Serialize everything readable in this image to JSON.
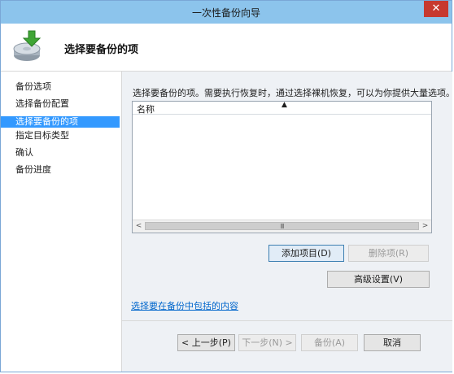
{
  "window": {
    "title": "一次性备份向导",
    "close_label": "✕"
  },
  "header": {
    "heading": "选择要备份的项",
    "icon": "backup-drive-icon"
  },
  "nav": {
    "items": [
      {
        "label": "备份选项",
        "selected": false
      },
      {
        "label": "选择备份配置",
        "selected": false
      },
      {
        "label": "选择要备份的项",
        "selected": true
      },
      {
        "label": "指定目标类型",
        "selected": false
      },
      {
        "label": "确认",
        "selected": false
      },
      {
        "label": "备份进度",
        "selected": false
      }
    ]
  },
  "main": {
    "description": "选择要备份的项。需要执行恢复时，通过选择裸机恢复，可以为你提供大量选项。",
    "list": {
      "column_name": "名称",
      "sort_glyph": "▲"
    },
    "scroll": {
      "left": "<",
      "right": ">",
      "grip": "III"
    },
    "buttons": {
      "add_item": "添加项目(D)",
      "remove_item": "删除项(R)",
      "advanced": "高级设置(V)"
    },
    "link": "选择要在备份中包括的内容"
  },
  "footer": {
    "back": "< 上一步(P)",
    "next": "下一步(N) >",
    "backup": "备份(A)",
    "cancel": "取消"
  },
  "colors": {
    "titlebar": "#8cc4ec",
    "selection": "#3399ff",
    "close": "#c7392f",
    "link": "#0066cc"
  }
}
